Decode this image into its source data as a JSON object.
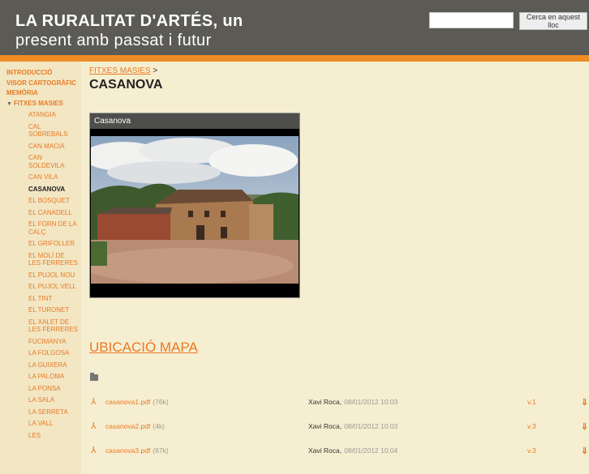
{
  "site": {
    "title_line1": "LA RURALITAT D'ARTÉS, un",
    "title_line2": "present amb passat i futur"
  },
  "search": {
    "value": "",
    "placeholder": "",
    "button_label": "Cerca en aquest lloc"
  },
  "colors": {
    "accent": "#f08c25",
    "link": "#e87a25",
    "header_bg": "#5b5a55",
    "page_bg": "#f6eed0"
  },
  "sidebar": {
    "top_items": [
      {
        "label": "INTRODUCCIÓ"
      },
      {
        "label": "VISOR CARTOGRÀFIC"
      },
      {
        "label": "MEMÒRIA"
      }
    ],
    "section": {
      "label": "FITXES MASIES",
      "icon": "triangle-down-icon"
    },
    "sub_items": [
      {
        "label": "ATANGIA"
      },
      {
        "label": "CAL SOBREBALS"
      },
      {
        "label": "CAN MACIÀ"
      },
      {
        "label": "CAN SOLDEVILA"
      },
      {
        "label": "CAN VILA"
      },
      {
        "label": "CASANOVA",
        "active": true
      },
      {
        "label": "EL BOSQUET"
      },
      {
        "label": "EL CANADELL"
      },
      {
        "label": "EL FORN DE LA CALÇ"
      },
      {
        "label": "EL GRIFOLLER"
      },
      {
        "label": "EL MOLÍ DE LES FERRERES"
      },
      {
        "label": "EL PUJOL NOU"
      },
      {
        "label": "EL PUJOL VELL"
      },
      {
        "label": "EL TINT"
      },
      {
        "label": "EL TURONET"
      },
      {
        "label": "EL XALET DE LES FERRERES"
      },
      {
        "label": "FUCIMANYA"
      },
      {
        "label": "LA FOLGOSA"
      },
      {
        "label": "LA GUIXERA"
      },
      {
        "label": "LA PALOMA"
      },
      {
        "label": "LA PONSA"
      },
      {
        "label": "LA SALA"
      },
      {
        "label": "LA SERRETA"
      },
      {
        "label": "LA VALL"
      },
      {
        "label": "LES"
      }
    ]
  },
  "main": {
    "breadcrumb": {
      "parent": "FITXES MASIES",
      "separator": ">"
    },
    "title": "CASANOVA",
    "gallery": {
      "caption": "Casanova"
    },
    "map_link": "UBICACIÓ MAPA",
    "files": [
      {
        "name": "casanova1.pdf",
        "size": "(76k)",
        "author": "Xavi Roca,",
        "date": "08/01/2012 10:03",
        "version": "v.1"
      },
      {
        "name": "casanova2.pdf",
        "size": "(4k)",
        "author": "Xavi Roca,",
        "date": "08/01/2012 10:03",
        "version": "v.3"
      },
      {
        "name": "casanova3.pdf",
        "size": "(67k)",
        "author": "Xavi Roca,",
        "date": "08/01/2012 10:04",
        "version": "v.3"
      }
    ]
  }
}
